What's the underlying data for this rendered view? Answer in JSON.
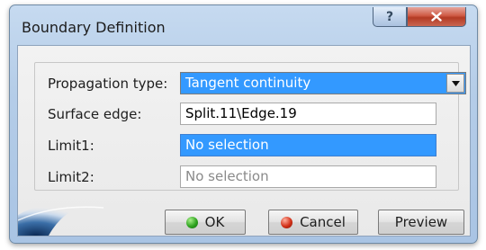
{
  "window": {
    "title": "Boundary Definition",
    "help_glyph": "?",
    "icons": {
      "help": "question-mark-icon",
      "close": "close-x-icon",
      "combo": "chevron-down-icon",
      "ok": "green-dot-icon",
      "cancel": "red-dot-icon"
    }
  },
  "form": {
    "propagation_type": {
      "label": "Propagation type:",
      "value": "Tangent continuity"
    },
    "surface_edge": {
      "label": "Surface edge:",
      "value": "Split.11\\Edge.19"
    },
    "limit1": {
      "label": "Limit1:",
      "value": "No selection"
    },
    "limit2": {
      "label": "Limit2:",
      "value": "No selection"
    }
  },
  "buttons": {
    "ok": "OK",
    "cancel": "Cancel",
    "preview": "Preview"
  },
  "colors": {
    "selection": "#3399ff",
    "title_gradient_top": "#c6daf0",
    "close_button_red": "#cf5a45",
    "dialog_background": "#f0f0f0"
  }
}
